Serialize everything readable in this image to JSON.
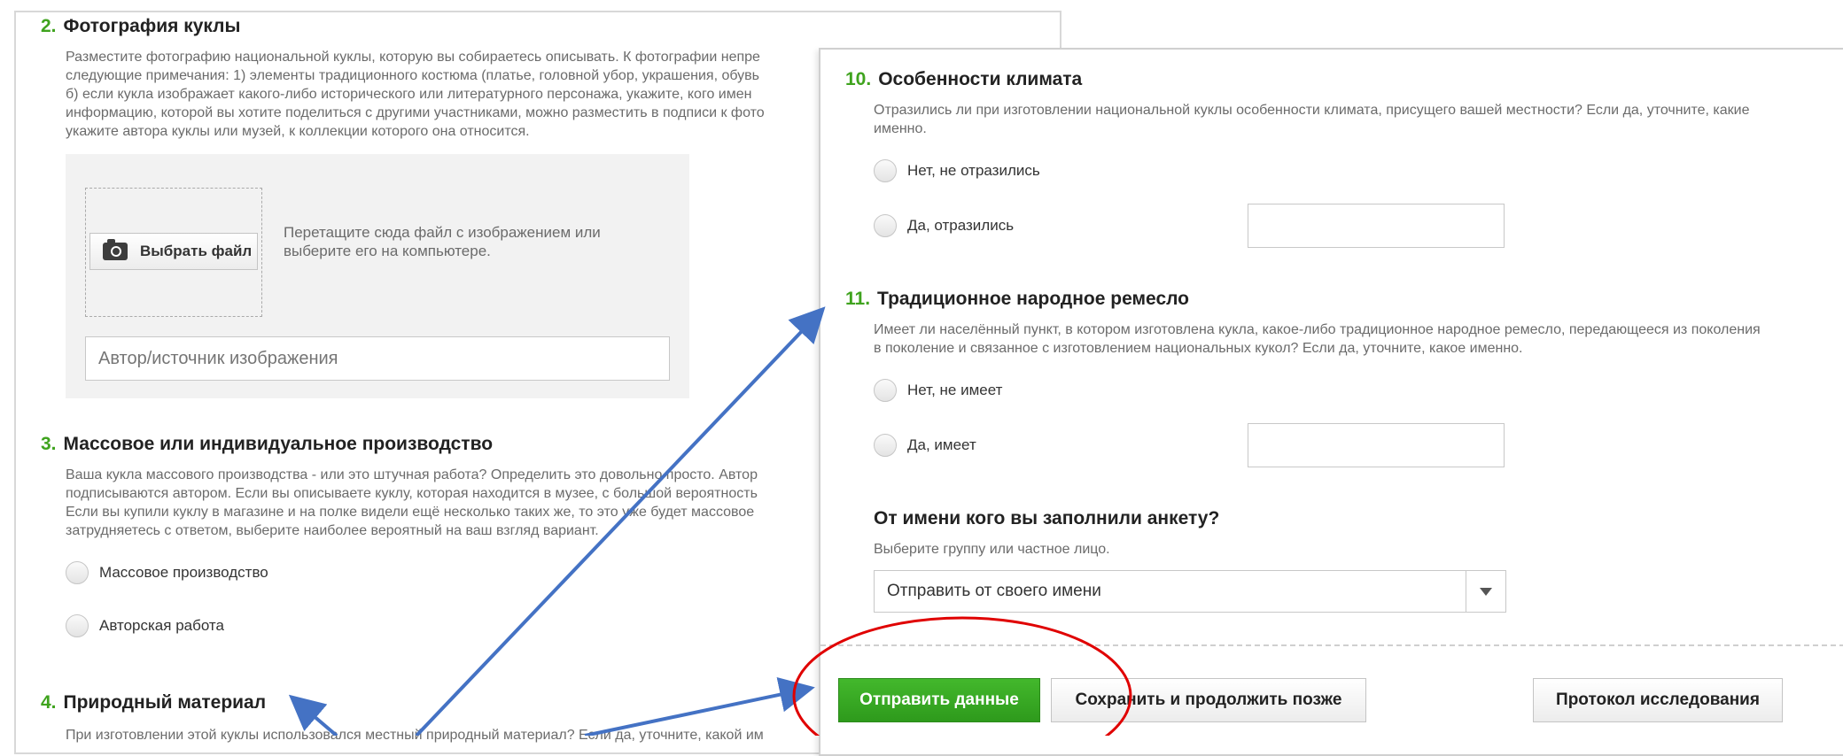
{
  "left": {
    "q2": {
      "num": "2.",
      "title": "Фотография куклы",
      "desc": [
        "Разместите фотографию национальной куклы, которую вы собираетесь описывать. К фотографии непре",
        "следующие примечания: 1) элементы традиционного костюма (платье, головной убор, украшения, обувь",
        "б) если кукла изображает какого-либо исторического или литературного персонажа, укажите, кого имен",
        "информацию, которой вы хотите поделиться с другими участниками, можно разместить в подписи к фото",
        "укажите автора куклы или музей, к коллекции которого она относится."
      ],
      "choose_file": "Выбрать файл",
      "drop_hint": [
        "Перетащите сюда файл с изображением или",
        "выберите его на компьютере."
      ],
      "author_placeholder": "Автор/источник изображения"
    },
    "q3": {
      "num": "3.",
      "title": "Массовое или индивидуальное производство",
      "desc": [
        "Ваша кукла массового производства - или это штучная работа? Определить это довольно просто. Автор",
        "подписываются автором. Если вы описываете куклу, которая находится в музее, с большой вероятность",
        "Если вы купили куклу в магазине и на полке видели ещё несколько таких же, то это уже будет массовое",
        "затрудняетесь с ответом, выберите наиболее вероятный на ваш взгляд вариант."
      ],
      "options": [
        "Массовое производство",
        "Авторская работа"
      ]
    },
    "q4": {
      "num": "4.",
      "title": "Природный материал",
      "desc": "При изготовлении этой куклы использовался местный природный материал? Если да, уточните, какой им"
    }
  },
  "right": {
    "q10": {
      "num": "10.",
      "title": "Особенности климата",
      "desc": [
        "Отразились ли при изготовлении национальной куклы особенности климата, присущего вашей местности? Если да, уточните, какие",
        "именно."
      ],
      "options": [
        "Нет, не отразились",
        "Да, отразились"
      ]
    },
    "q11": {
      "num": "11.",
      "title": "Традиционное народное ремесло",
      "desc": [
        "Имеет ли населённый пункт, в котором изготовлена кукла, какое-либо традиционное народное ремесло, передающееся из поколения",
        "в поколение и связанное с изготовлением национальных кукол? Если да, уточните, какое именно."
      ],
      "options": [
        "Нет, не имеет",
        "Да, имеет"
      ]
    },
    "sender": {
      "title": "От имени кого вы заполнили анкету?",
      "hint": "Выберите группу или частное лицо.",
      "selected": "Отправить от своего имени"
    },
    "buttons": {
      "submit": "Отправить данные",
      "save_later": "Сохранить и продолжить позже",
      "protocol": "Протокол исследования"
    }
  },
  "colors": {
    "accent_green": "#3fa31e",
    "arrow_blue": "#4472c4",
    "highlight_red": "#e00000"
  }
}
